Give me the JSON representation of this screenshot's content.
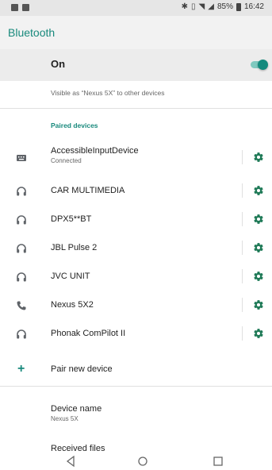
{
  "status_bar": {
    "battery_text": "85%",
    "time": "16:42",
    "icons": [
      "bluetooth-icon",
      "vibrate-icon",
      "wifi-icon",
      "signal-icon",
      "battery-icon"
    ]
  },
  "app_bar": {
    "title": "Bluetooth"
  },
  "bluetooth_toggle": {
    "label": "On",
    "state": "on",
    "accent": "#138a7d"
  },
  "visibility_text": "Visible as “Nexus 5X” to other devices",
  "paired_header": "Paired devices",
  "devices": [
    {
      "name": "AccessibleInputDevice",
      "status": "Connected",
      "icon": "keyboard-icon"
    },
    {
      "name": "CAR MULTIMEDIA",
      "status": "",
      "icon": "headset-icon"
    },
    {
      "name": "DPX5**BT",
      "status": "",
      "icon": "headset-icon"
    },
    {
      "name": "JBL Pulse 2",
      "status": "",
      "icon": "headset-icon"
    },
    {
      "name": "JVC UNIT",
      "status": "",
      "icon": "headset-icon"
    },
    {
      "name": "Nexus 5X2",
      "status": "",
      "icon": "phone-icon"
    },
    {
      "name": "Phonak ComPilot II",
      "status": "",
      "icon": "headset-icon"
    }
  ],
  "pair_new": {
    "label": "Pair new device"
  },
  "device_name": {
    "label": "Device name",
    "value": "Nexus 5X"
  },
  "received_files": {
    "label": "Received files"
  },
  "nav_bar": {
    "buttons": [
      "back",
      "home",
      "recents"
    ]
  },
  "colors": {
    "accent": "#18897c",
    "gear": "#1f7a57",
    "toggle_track": "#7fc9bf"
  }
}
